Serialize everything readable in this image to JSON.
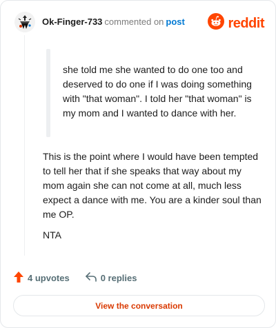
{
  "header": {
    "username": "Ok-Finger-733",
    "commented_text": "commented on",
    "post_link": "post"
  },
  "brand": {
    "name": "reddit",
    "color": "#ff4500",
    "icon": "reddit-snoo-icon"
  },
  "comment": {
    "quote": "she told me she wanted to do one too and deserved to do one if I was doing something with \"that woman\". I told her \"that woman\" is my mom and I wanted to dance with her.",
    "body": "This is the point where I would have been tempted to tell her that if she speaks that way about my mom again she can not come at all, much less expect a dance with me. You are a kinder soul than me OP.",
    "closing": "NTA"
  },
  "actions": {
    "upvotes": "4 upvotes",
    "upvote_icon": "arrow-up-icon",
    "upvote_color": "#ff4500",
    "replies": "0 replies",
    "reply_icon": "reply-arrow-icon"
  },
  "footer": {
    "button_label": "View the conversation",
    "button_color": "#d93900"
  }
}
